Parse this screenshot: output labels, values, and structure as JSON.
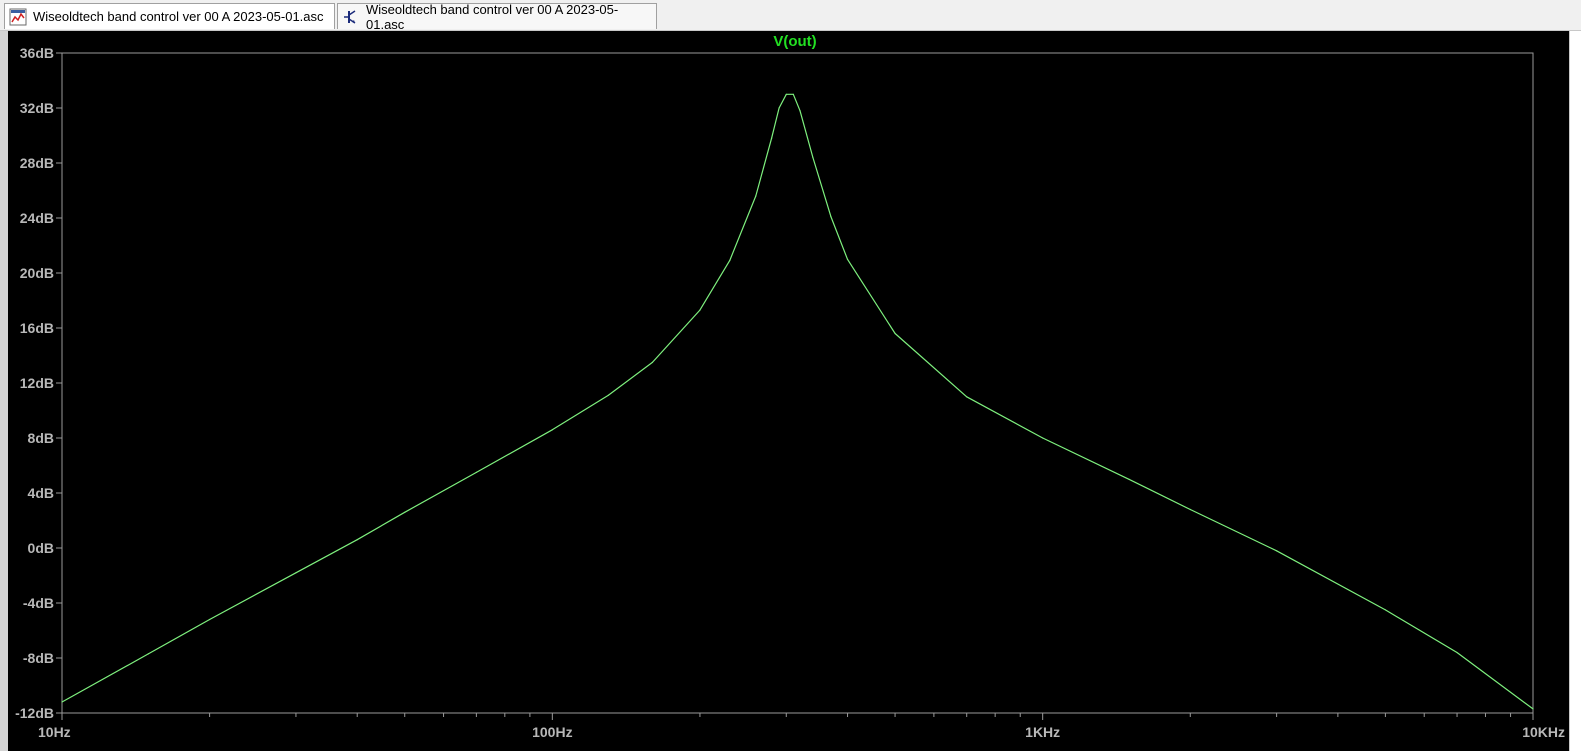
{
  "tabs": [
    {
      "label": "Wiseoldtech band control ver 00 A 2023-05-01.asc",
      "icon": "waveform-plot-icon",
      "active": true
    },
    {
      "label": "Wiseoldtech band control ver 00 A 2023-05-01.asc",
      "icon": "schematic-icon",
      "active": false
    }
  ],
  "colors": {
    "background": "#000000",
    "axis": "#9a9a9a",
    "tick_text": "#b8b8b8",
    "trace": "#7ef07e",
    "title": "#22e022"
  },
  "chart_data": {
    "type": "line",
    "title": "V(out)",
    "x_scale": "log",
    "xlim": [
      10,
      10000
    ],
    "ylim": [
      -12,
      36
    ],
    "x_ticks": [
      {
        "value": 10,
        "label": "10Hz"
      },
      {
        "value": 100,
        "label": "100Hz"
      },
      {
        "value": 1000,
        "label": "1KHz"
      },
      {
        "value": 10000,
        "label": "10KHz"
      }
    ],
    "y_ticks": [
      {
        "value": 36,
        "label": "36dB"
      },
      {
        "value": 32,
        "label": "32dB"
      },
      {
        "value": 28,
        "label": "28dB"
      },
      {
        "value": 24,
        "label": "24dB"
      },
      {
        "value": 20,
        "label": "20dB"
      },
      {
        "value": 16,
        "label": "16dB"
      },
      {
        "value": 12,
        "label": "12dB"
      },
      {
        "value": 8,
        "label": "8dB"
      },
      {
        "value": 4,
        "label": "4dB"
      },
      {
        "value": 0,
        "label": "0dB"
      },
      {
        "value": -4,
        "label": "-4dB"
      },
      {
        "value": -8,
        "label": "-8dB"
      },
      {
        "value": -12,
        "label": "-12dB"
      }
    ],
    "grid": false,
    "series": [
      {
        "name": "V(out)",
        "x": [
          10,
          15,
          20,
          30,
          40,
          50,
          70,
          100,
          130,
          160,
          200,
          230,
          260,
          280,
          290,
          300,
          310,
          320,
          340,
          370,
          400,
          500,
          700,
          1000,
          1500,
          2000,
          3000,
          5000,
          7000,
          10000
        ],
        "y": [
          -11.2,
          -7.7,
          -5.2,
          -1.8,
          0.6,
          2.6,
          5.5,
          8.6,
          11.1,
          13.5,
          17.3,
          20.9,
          25.6,
          29.8,
          32.0,
          33.0,
          33.0,
          31.8,
          28.4,
          24.1,
          21.0,
          15.6,
          11.0,
          8.0,
          5.0,
          2.8,
          -0.2,
          -4.5,
          -7.6,
          -11.7
        ]
      }
    ]
  }
}
